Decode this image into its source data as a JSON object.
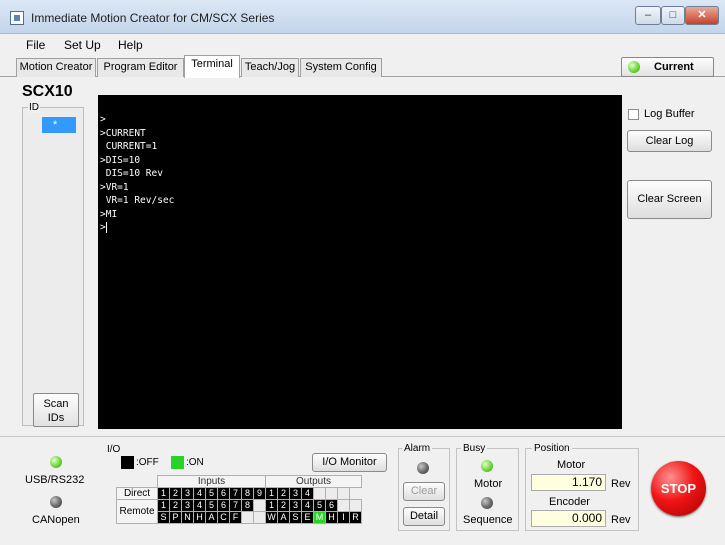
{
  "window": {
    "title": "Immediate Motion Creator for CM/SCX Series",
    "min_glyph": "–",
    "max_glyph": "□",
    "close_glyph": "✕"
  },
  "menu": [
    "File",
    "Set Up",
    "Help"
  ],
  "tabs": [
    "Motion Creator",
    "Program Editor",
    "Terminal",
    "Teach/Jog",
    "System Config"
  ],
  "active_tab": "Terminal",
  "current_button": "Current",
  "left_panel": {
    "model": "SCX10",
    "id_label": "ID",
    "id_selected": "*",
    "scan_button_line1": "Scan",
    "scan_button_line2": "IDs"
  },
  "terminal": {
    "lines": [
      ">",
      ">CURRENT",
      " CURRENT=1",
      ">DIS=10",
      " DIS=10 Rev",
      ">VR=1",
      " VR=1 Rev/sec",
      ">MI",
      ">"
    ]
  },
  "right_panel": {
    "log_buffer_label": "Log Buffer",
    "log_buffer_checked": false,
    "clear_log": "Clear Log",
    "clear_screen": "Clear Screen"
  },
  "connection": {
    "usb": "USB/RS232",
    "can": "CANopen"
  },
  "io": {
    "title": "I/O",
    "off_label": ":OFF",
    "on_label": ":ON",
    "monitor_button": "I/O Monitor",
    "inputs_header": "Inputs",
    "outputs_header": "Outputs",
    "direct_label": "Direct",
    "remote_label": "Remote",
    "direct_inputs": [
      "1",
      "2",
      "3",
      "4",
      "5",
      "6",
      "7",
      "8",
      "9"
    ],
    "direct_outputs": [
      "1",
      "2",
      "3",
      "4",
      "",
      "",
      ""
    ],
    "remote_inputs_numbers": [
      "1",
      "2",
      "3",
      "4",
      "5",
      "6",
      "7",
      "8",
      ""
    ],
    "remote_inputs_letters": [
      "S",
      "P",
      "N",
      "H",
      "A",
      "C",
      "F",
      "",
      ""
    ],
    "remote_outputs_numbers": [
      "1",
      "2",
      "3",
      "4",
      "5",
      "6",
      "",
      ""
    ],
    "remote_outputs_letters": [
      "W",
      "A",
      "S",
      "E",
      "M",
      "H",
      "I",
      "R"
    ],
    "remote_outputs_on_index": 4
  },
  "alarm": {
    "label": "Alarm",
    "clear": "Clear",
    "detail": "Detail"
  },
  "busy": {
    "label": "Busy",
    "motor": "Motor",
    "sequence": "Sequence"
  },
  "position": {
    "label": "Position",
    "motor_label": "Motor",
    "motor_value": "1.170",
    "encoder_label": "Encoder",
    "encoder_value": "0.000",
    "unit": "Rev"
  },
  "stop_button": "STOP",
  "colors": {
    "terminal_bg": "#000000",
    "led_on": "#39c61c",
    "io_on": "#27d327",
    "selection": "#3399ff",
    "stop": "#e01010"
  }
}
